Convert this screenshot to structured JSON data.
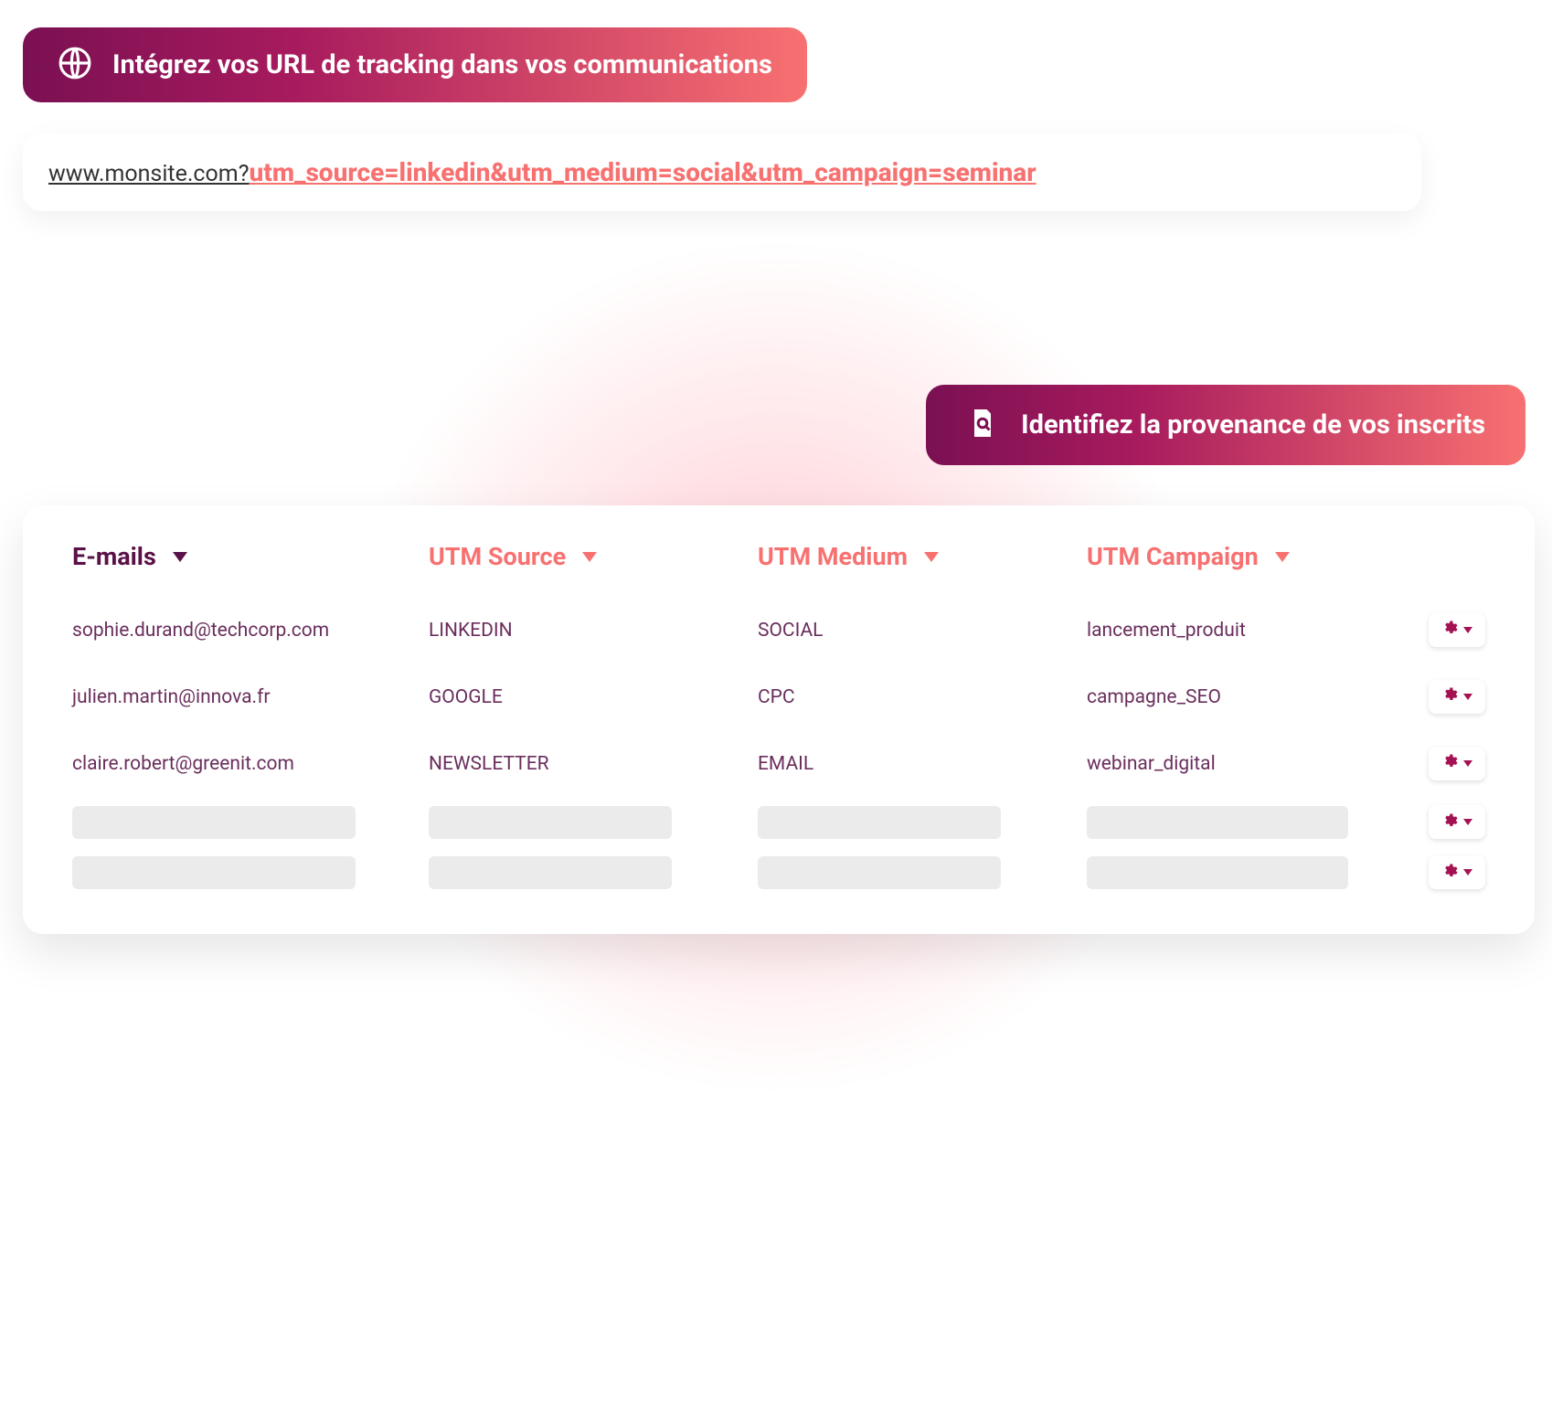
{
  "banner1": {
    "title": "Intégrez vos URL de tracking dans vos communications"
  },
  "url_example": {
    "base": "www.monsite.com?",
    "params": "utm_source=linkedin&utm_medium=social&utm_campaign=seminar"
  },
  "banner2": {
    "title": "Identifiez la provenance de vos inscrits"
  },
  "table": {
    "headers": {
      "emails": "E-mails",
      "utm_source": "UTM Source",
      "utm_medium": "UTM Medium",
      "utm_campaign": "UTM Campaign"
    },
    "rows": [
      {
        "email": "sophie.durand@techcorp.com",
        "source": "LINKEDIN",
        "medium": "SOCIAL",
        "campaign": "lancement_produit"
      },
      {
        "email": "julien.martin@innova.fr",
        "source": "GOOGLE",
        "medium": "CPC",
        "campaign": "campagne_SEO"
      },
      {
        "email": "claire.robert@greenit.com",
        "source": "NEWSLETTER",
        "medium": "EMAIL",
        "campaign": "webinar_digital"
      }
    ],
    "placeholder_rows": 2
  }
}
